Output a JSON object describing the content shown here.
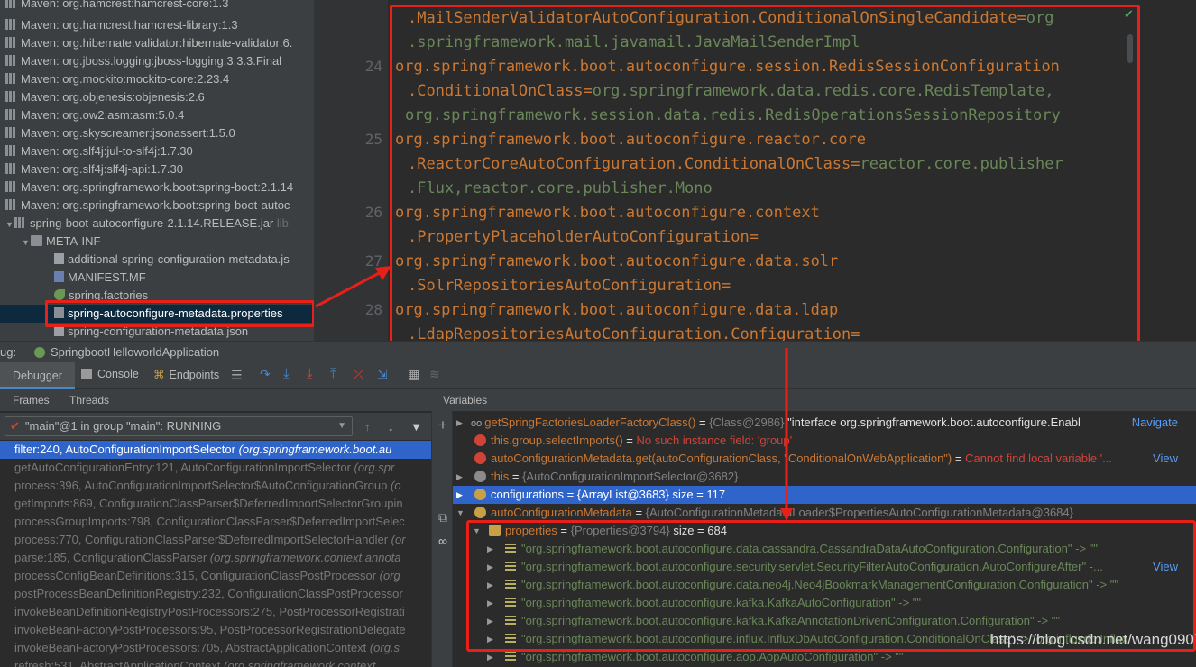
{
  "tree": {
    "items": [
      {
        "label": "Maven: org.hamcrest:hamcrest-core:1.3",
        "icon": "library-icon"
      },
      {
        "label": "Maven: org.hamcrest:hamcrest-library:1.3",
        "icon": "library-icon"
      },
      {
        "label": "Maven: org.hibernate.validator:hibernate-validator:6.",
        "icon": "library-icon"
      },
      {
        "label": "Maven: org.jboss.logging:jboss-logging:3.3.3.Final",
        "icon": "library-icon"
      },
      {
        "label": "Maven: org.mockito:mockito-core:2.23.4",
        "icon": "library-icon"
      },
      {
        "label": "Maven: org.objenesis:objenesis:2.6",
        "icon": "library-icon"
      },
      {
        "label": "Maven: org.ow2.asm:asm:5.0.4",
        "icon": "library-icon"
      },
      {
        "label": "Maven: org.skyscreamer:jsonassert:1.5.0",
        "icon": "library-icon"
      },
      {
        "label": "Maven: org.slf4j:jul-to-slf4j:1.7.30",
        "icon": "library-icon"
      },
      {
        "label": "Maven: org.slf4j:slf4j-api:1.7.30",
        "icon": "library-icon"
      },
      {
        "label": "Maven: org.springframework.boot:spring-boot:2.1.14",
        "icon": "library-icon"
      },
      {
        "label": "Maven: org.springframework.boot:spring-boot-autoc",
        "icon": "library-icon"
      }
    ],
    "jar": {
      "label": "spring-boot-autoconfigure-2.1.14.RELEASE.jar",
      "suffix": "lib"
    },
    "folder": "META-INF",
    "files": [
      {
        "label": "additional-spring-configuration-metadata.js",
        "icon": "json-file-icon"
      },
      {
        "label": "MANIFEST.MF",
        "icon": "manifest-file-icon"
      },
      {
        "label": "spring.factories",
        "icon": "spring-file-icon"
      },
      {
        "label": "spring-autoconfigure-metadata.properties",
        "icon": "properties-file-icon"
      },
      {
        "label": "spring-configuration-metadata.json",
        "icon": "json-file-icon"
      }
    ]
  },
  "editor": {
    "line_numbers": [
      "24",
      "25",
      "26",
      "27",
      "28"
    ],
    "lines": [
      {
        "key": ".MailSenderValidatorAutoConfiguration.ConditionalOnSingleCandidate=",
        "value": "org"
      },
      {
        "key": "",
        "value": ".springframework.mail.javamail.JavaMailSenderImpl"
      },
      {
        "key": "org.springframework.boot.autoconfigure.session.RedisSessionConfiguration",
        "value": ""
      },
      {
        "key": ".ConditionalOnClass=",
        "value": "org.springframework.data.redis.core.RedisTemplate,"
      },
      {
        "key": "",
        "value": "org.springframework.session.data.redis.RedisOperationsSessionRepository"
      },
      {
        "key": "org.springframework.boot.autoconfigure.reactor.core",
        "value": ""
      },
      {
        "key": ".ReactorCoreAutoConfiguration.ConditionalOnClass=",
        "value": "reactor.core.publisher"
      },
      {
        "key": "",
        "value": ".Flux,reactor.core.publisher.Mono"
      },
      {
        "key": "org.springframework.boot.autoconfigure.context",
        "value": ""
      },
      {
        "key": ".PropertyPlaceholderAutoConfiguration=",
        "value": ""
      },
      {
        "key": "org.springframework.boot.autoconfigure.data.solr",
        "value": ""
      },
      {
        "key": ".SolrRepositoriesAutoConfiguration=",
        "value": ""
      },
      {
        "key": "org.springframework.boot.autoconfigure.data.ldap",
        "value": ""
      },
      {
        "key": ".LdapRepositoriesAutoConfiguration.Configuration=",
        "value": ""
      }
    ]
  },
  "debug": {
    "label": "ug:",
    "config_name": "SpringbootHelloworldApplication",
    "tabs": {
      "debugger": "Debugger",
      "console": "Console",
      "endpoints": "Endpoints"
    },
    "frames_tab": "Frames",
    "threads_tab": "Threads",
    "variables_title": "Variables",
    "thread_selector": "\"main\"@1 in group \"main\": RUNNING",
    "frames": [
      {
        "method": "filter:240, AutoConfigurationImportSelector",
        "pkg": "(org.springframework.boot.au"
      },
      {
        "method": "getAutoConfigurationEntry:121, AutoConfigurationImportSelector",
        "pkg": "(org.spr"
      },
      {
        "method": "process:396, AutoConfigurationImportSelector$AutoConfigurationGroup",
        "pkg": "(o"
      },
      {
        "method": "getImports:869, ConfigurationClassParser$DeferredImportSelectorGroupin",
        "pkg": ""
      },
      {
        "method": "processGroupImports:798, ConfigurationClassParser$DeferredImportSelec",
        "pkg": ""
      },
      {
        "method": "process:770, ConfigurationClassParser$DeferredImportSelectorHandler",
        "pkg": "(or"
      },
      {
        "method": "parse:185, ConfigurationClassParser",
        "pkg": "(org.springframework.context.annota"
      },
      {
        "method": "processConfigBeanDefinitions:315, ConfigurationClassPostProcessor",
        "pkg": "(org"
      },
      {
        "method": "postProcessBeanDefinitionRegistry:232, ConfigurationClassPostProcessor",
        "pkg": ""
      },
      {
        "method": "invokeBeanDefinitionRegistryPostProcessors:275, PostProcessorRegistrati",
        "pkg": ""
      },
      {
        "method": "invokeBeanFactoryPostProcessors:95, PostProcessorRegistrationDelegate",
        "pkg": ""
      },
      {
        "method": "invokeBeanFactoryPostProcessors:705, AbstractApplicationContext",
        "pkg": "(org.s"
      },
      {
        "method": "refresh:531, AbstractApplicationContext",
        "pkg": "(org.springframework.context"
      }
    ],
    "variables": {
      "row1": {
        "name": "getSpringFactoriesLoaderFactoryClass()",
        "eq": " = ",
        "type": "{Class@2986}",
        "value": " \"interface org.springframework.boot.autoconfigure.Enabl",
        "link": "Navigate"
      },
      "row2": {
        "name": "this.group.selectImports()",
        "eq": " = ",
        "error": "No such instance field: 'group'"
      },
      "row3": {
        "name": "autoConfigurationMetadata.get(autoConfigurationClass, \"ConditionalOnWebApplication\")",
        "eq": " = ",
        "error": "Cannot find local variable '...",
        "link": "View"
      },
      "row4": {
        "name": "this",
        "eq": " = ",
        "type": "{AutoConfigurationImportSelector@3682}"
      },
      "row5": {
        "name": "configurations",
        "eq": " = ",
        "value": "{ArrayList@3683}  size = 117"
      },
      "row6": {
        "name": "autoConfigurationMetadata",
        "eq": " = ",
        "type": "{AutoConfigurationMetadataLoader$PropertiesAutoConfigurationMetadata@3684}"
      },
      "row7": {
        "name": "properties",
        "eq": " = ",
        "type": "{Properties@3794}",
        "value": "  size = 684"
      },
      "entries": [
        {
          "text": "\"org.springframework.boot.autoconfigure.data.cassandra.CassandraDataAutoConfiguration.Configuration\" -> \"\"",
          "link": ""
        },
        {
          "text": "\"org.springframework.boot.autoconfigure.security.servlet.SecurityFilterAutoConfiguration.AutoConfigureAfter\" -...",
          "link": "View"
        },
        {
          "text": "\"org.springframework.boot.autoconfigure.data.neo4j.Neo4jBookmarkManagementConfiguration.Configuration\" -> \"\"",
          "link": ""
        },
        {
          "text": "\"org.springframework.boot.autoconfigure.kafka.KafkaAutoConfiguration\" -> \"\"",
          "link": ""
        },
        {
          "text": "\"org.springframework.boot.autoconfigure.kafka.KafkaAnnotationDrivenConfiguration.Configuration\" -> \"\"",
          "link": ""
        },
        {
          "text": "\"org.springframework.boot.autoconfigure.influx.InfluxDbAutoConfiguration.ConditionalOnClass\" -> \"org.influxdb.Influx",
          "link": ""
        },
        {
          "text": "\"org.springframework.boot.autoconfigure.aop.AopAutoConfiguration\" -> \"\"",
          "link": ""
        }
      ]
    }
  },
  "watermark": "https://blog.csdn.net/wang0907",
  "colors": {
    "highlight": "#e8201a",
    "selection": "#2f65ca",
    "keyword": "#cc7832",
    "string": "#6a8759"
  }
}
